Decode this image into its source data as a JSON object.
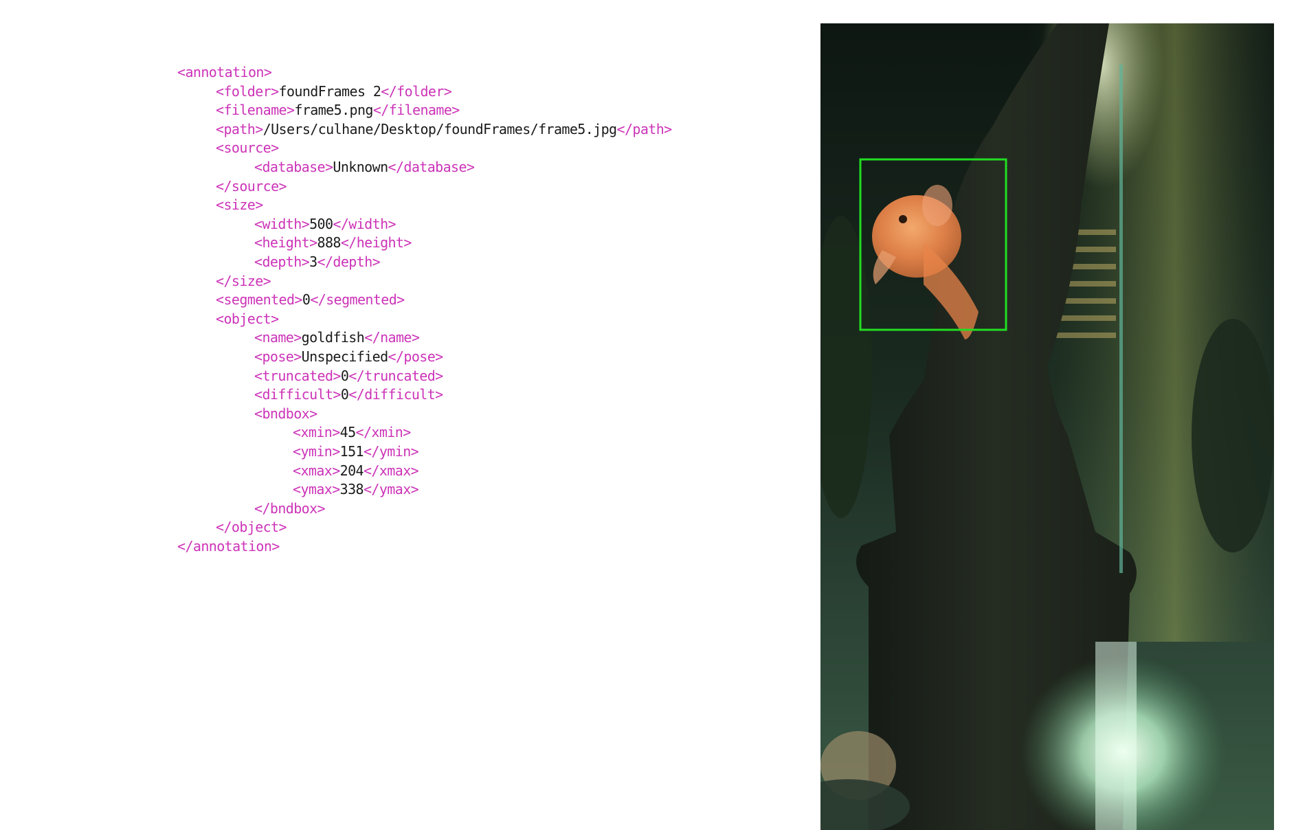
{
  "annotation_xml": {
    "lines": [
      {
        "indent": 0,
        "open": "<annotation>",
        "value": "",
        "close": ""
      },
      {
        "indent": 1,
        "open": "<folder>",
        "value": "foundFrames 2",
        "close": "</folder>"
      },
      {
        "indent": 1,
        "open": "<filename>",
        "value": "frame5.png",
        "close": "</filename>"
      },
      {
        "indent": 1,
        "open": "<path>",
        "value": "/Users/culhane/Desktop/foundFrames/frame5.jpg",
        "close": "</path>"
      },
      {
        "indent": 1,
        "open": "<source>",
        "value": "",
        "close": ""
      },
      {
        "indent": 2,
        "open": "<database>",
        "value": "Unknown",
        "close": "</database>"
      },
      {
        "indent": 1,
        "open": "</source>",
        "value": "",
        "close": ""
      },
      {
        "indent": 1,
        "open": "<size>",
        "value": "",
        "close": ""
      },
      {
        "indent": 2,
        "open": "<width>",
        "value": "500",
        "close": "</width>"
      },
      {
        "indent": 2,
        "open": "<height>",
        "value": "888",
        "close": "</height>"
      },
      {
        "indent": 2,
        "open": "<depth>",
        "value": "3",
        "close": "</depth>"
      },
      {
        "indent": 1,
        "open": "</size>",
        "value": "",
        "close": ""
      },
      {
        "indent": 1,
        "open": "<segmented>",
        "value": "0",
        "close": "</segmented>"
      },
      {
        "indent": 1,
        "open": "<object>",
        "value": "",
        "close": ""
      },
      {
        "indent": 2,
        "open": "<name>",
        "value": "goldfish",
        "close": "</name>"
      },
      {
        "indent": 2,
        "open": "<pose>",
        "value": "Unspecified",
        "close": "</pose>"
      },
      {
        "indent": 2,
        "open": "<truncated>",
        "value": "0",
        "close": "</truncated>"
      },
      {
        "indent": 2,
        "open": "<difficult>",
        "value": "0",
        "close": "</difficult>"
      },
      {
        "indent": 2,
        "open": "<bndbox>",
        "value": "",
        "close": ""
      },
      {
        "indent": 3,
        "open": "<xmin>",
        "value": "45",
        "close": "</xmin>"
      },
      {
        "indent": 3,
        "open": "<ymin>",
        "value": "151",
        "close": "</ymin>"
      },
      {
        "indent": 3,
        "open": "<xmax>",
        "value": "204",
        "close": "</xmax>"
      },
      {
        "indent": 3,
        "open": "<ymax>",
        "value": "338",
        "close": "</ymax>"
      },
      {
        "indent": 2,
        "open": "</bndbox>",
        "value": "",
        "close": ""
      },
      {
        "indent": 1,
        "open": "</object>",
        "value": "",
        "close": ""
      },
      {
        "indent": 0,
        "open": "</annotation>",
        "value": "",
        "close": ""
      }
    ]
  },
  "image_preview": {
    "bounding_box_color": "#22dd22",
    "tag_color": "#cc33b8",
    "value_color": "#1a1a1a"
  }
}
